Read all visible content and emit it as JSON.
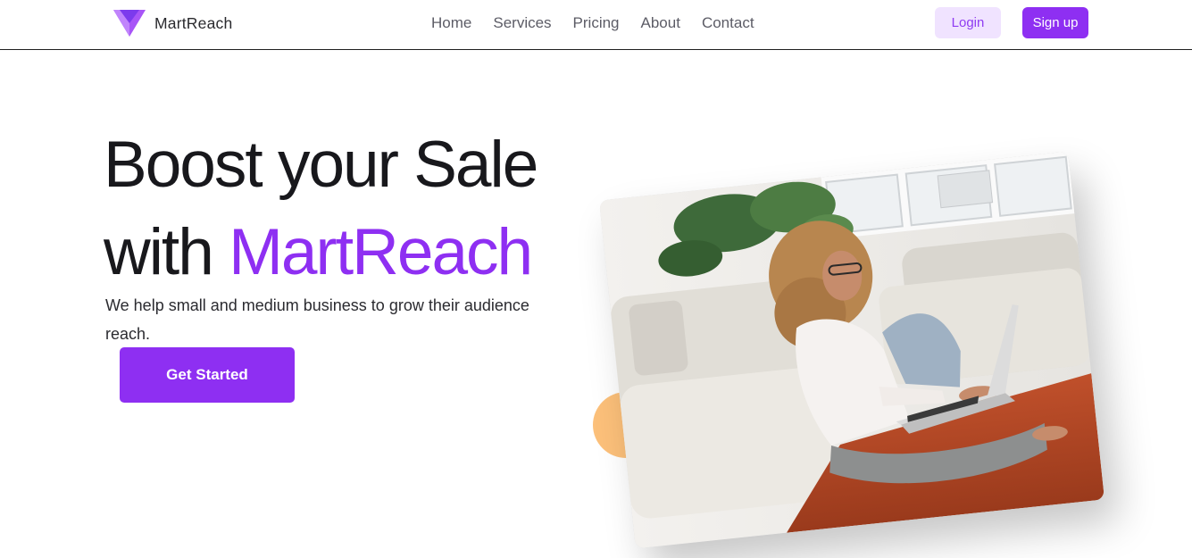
{
  "brand": {
    "name": "MartReach",
    "logo_icon": "diamond-gem-icon",
    "accent_color": "#8e2ff2"
  },
  "nav": {
    "links": [
      "Home",
      "Services",
      "Pricing",
      "About",
      "Contact"
    ]
  },
  "auth": {
    "login_label": "Login",
    "signup_label": "Sign up"
  },
  "hero": {
    "title_line1": "Boost your Sale",
    "title_prefix": "with",
    "title_brand": "MartReach",
    "subtitle": "We help small and medium business to grow their audience reach.",
    "cta_label": "Get Started",
    "image_description_icon": "woman-laptop-photo",
    "decor_color": "#fcc07a"
  }
}
